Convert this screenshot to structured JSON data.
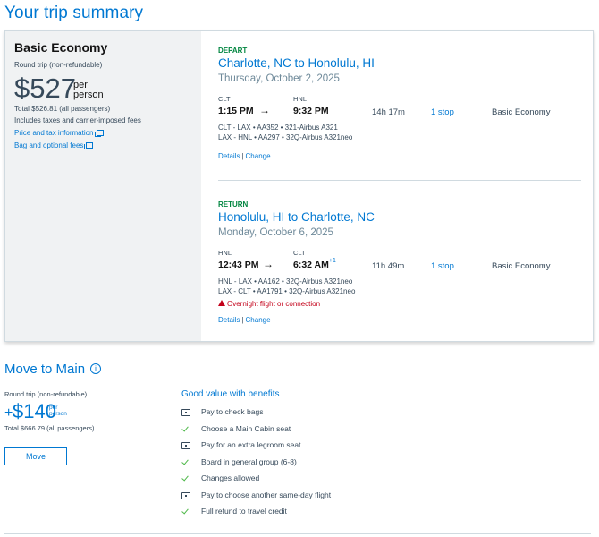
{
  "page_title": "Your trip summary",
  "fare": {
    "name": "Basic Economy",
    "subtitle": "Round trip (non-refundable)",
    "price": "$527",
    "per1": "per",
    "per2": "person",
    "total": "Total $526.81 (all passengers)",
    "includes": "Includes taxes and carrier-imposed fees",
    "link_tax": "Price and tax information",
    "link_bag": "Bag and optional fees"
  },
  "depart": {
    "label": "DEPART",
    "route": "Charlotte, NC to Honolulu, HI",
    "date": "Thursday, October 2, 2025",
    "from_code": "CLT",
    "to_code": "HNL",
    "dep_time": "1:15 PM",
    "arrow": "→",
    "arr_time": "9:32 PM",
    "duration": "14h 17m",
    "stops": "1 stop",
    "cabin": "Basic Economy",
    "legs": [
      "CLT - LAX • AA352 • 321-Airbus A321",
      "LAX - HNL • AA297 • 32Q-Airbus A321neo"
    ],
    "details": "Details",
    "sep": "|",
    "change": "Change"
  },
  "return": {
    "label": "RETURN",
    "route": "Honolulu, HI to Charlotte, NC",
    "date": "Monday, October 6, 2025",
    "from_code": "HNL",
    "to_code": "CLT",
    "dep_time": "12:43 PM",
    "arrow": "→",
    "arr_time": "6:32 AM",
    "arr_sup": "+1",
    "duration": "11h 49m",
    "stops": "1 stop",
    "cabin": "Basic Economy",
    "legs": [
      "HNL - LAX • AA162 • 32Q-Airbus A321neo",
      "LAX - CLT • AA1791 • 32Q-Airbus A321neo"
    ],
    "warning": "Overnight flight or connection",
    "details": "Details",
    "sep": "|",
    "change": "Change"
  },
  "move": {
    "title": "Move to Main",
    "info_glyph": "i",
    "subtitle": "Round trip (non-refundable)",
    "plus": "+",
    "price": "$140",
    "per1": "per",
    "per2": "person",
    "total": "Total $666.79 (all passengers)",
    "button": "Move"
  },
  "benefits": {
    "title": "Good value with benefits",
    "items": [
      {
        "icon": "bag-icon",
        "text": "Pay to check bags"
      },
      {
        "icon": "check-icon",
        "text": "Choose a Main Cabin seat"
      },
      {
        "icon": "bag-icon",
        "text": "Pay for an extra legroom seat"
      },
      {
        "icon": "check-icon",
        "text": "Board in general group (6-8)"
      },
      {
        "icon": "check-icon",
        "text": "Changes allowed"
      },
      {
        "icon": "bag-icon",
        "text": "Pay to choose another same-day flight"
      },
      {
        "icon": "check-icon",
        "text": "Full refund to travel credit"
      }
    ]
  },
  "colors": {
    "accent": "#0078d2",
    "depart_label": "#00853f",
    "warning": "#c30019",
    "check": "#4db848"
  }
}
